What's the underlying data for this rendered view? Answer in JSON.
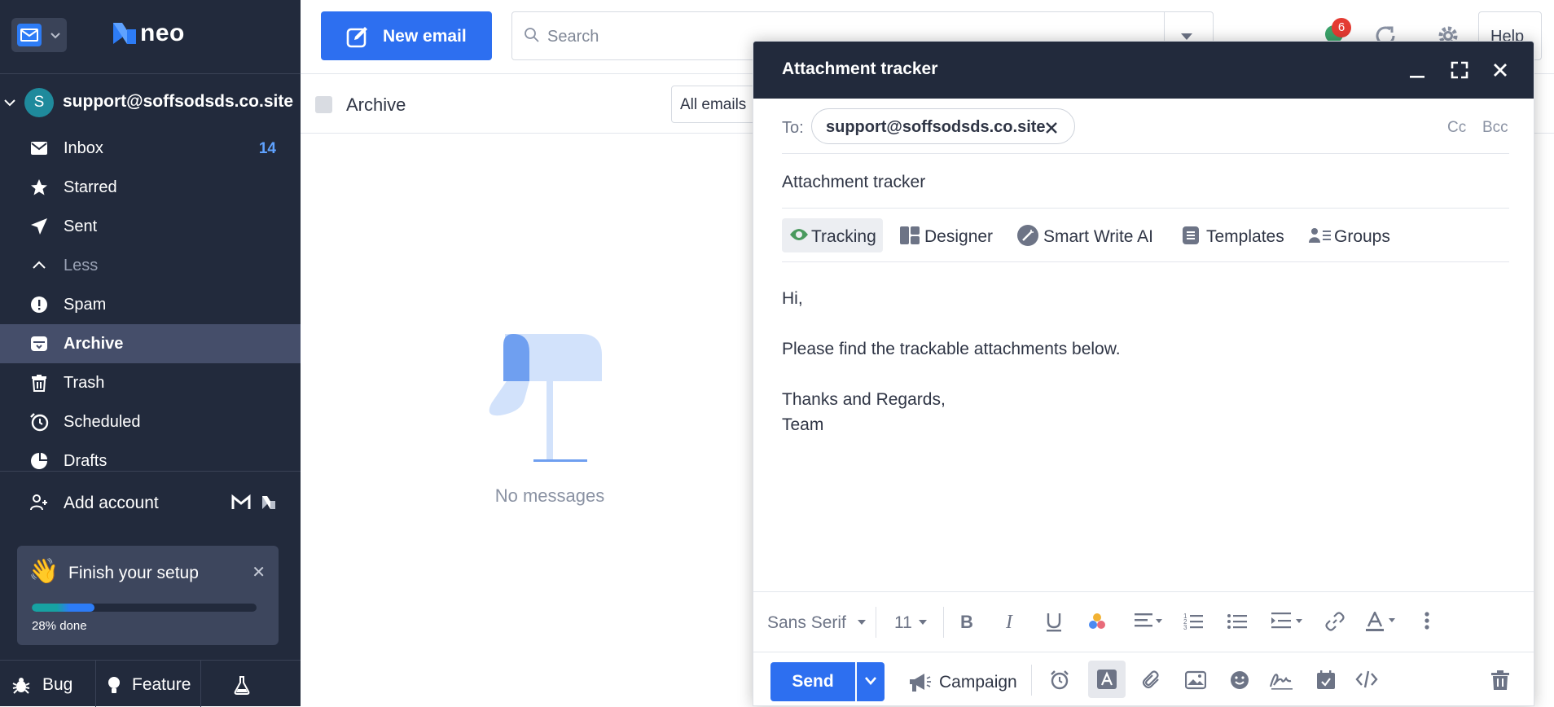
{
  "sidebar": {
    "logo_text": "neo",
    "account_initial": "S",
    "account_email": "support@soffsodsds.co.site",
    "nav": [
      {
        "label": "Inbox",
        "count": "14",
        "icon": "envelope-icon",
        "active": false
      },
      {
        "label": "Starred",
        "count": "",
        "icon": "star-icon",
        "active": false
      },
      {
        "label": "Sent",
        "count": "",
        "icon": "paper-plane-icon",
        "active": false
      },
      {
        "label": "Less",
        "count": "",
        "icon": "chevron-up-icon",
        "active": false
      },
      {
        "label": "Spam",
        "count": "",
        "icon": "alert-circle-icon",
        "active": false
      },
      {
        "label": "Archive",
        "count": "",
        "icon": "archive-icon",
        "active": true
      },
      {
        "label": "Trash",
        "count": "",
        "icon": "trash-icon",
        "active": false
      },
      {
        "label": "Scheduled",
        "count": "",
        "icon": "clock-icon",
        "active": false
      },
      {
        "label": "Drafts",
        "count": "",
        "icon": "draft-icon",
        "active": false
      }
    ],
    "add_account": "Add account",
    "setup": {
      "title": "Finish your setup",
      "progress_label": "28% done",
      "progress": 0.28
    },
    "bottom": {
      "bug": "Bug",
      "feature": "Feature"
    }
  },
  "topbar": {
    "new_email": "New email",
    "search_placeholder": "Search",
    "notification_count": "6",
    "help": "Help"
  },
  "list": {
    "folder_title": "Archive",
    "filter": "All emails",
    "empty_message": "No messages"
  },
  "compose": {
    "title": "Attachment tracker",
    "to_label": "To:",
    "to_recipient": "support@soffsodsds.co.site",
    "cc": "Cc",
    "bcc": "Bcc",
    "subject": "Attachment tracker",
    "tools": [
      "Tracking",
      "Designer",
      "Smart Write AI",
      "Templates",
      "Groups"
    ],
    "body": [
      "Hi,",
      "",
      "Please find the trackable attachments below.",
      "",
      "Thanks and Regards,",
      "Team"
    ],
    "font_family": "Sans Serif",
    "font_size": "11",
    "send": "Send",
    "campaign": "Campaign"
  },
  "colors": {
    "sidebar_bg": "#222a3c",
    "accent": "#2d6ff0",
    "active_nav": "#454e6a",
    "badge": "#e43b32"
  }
}
